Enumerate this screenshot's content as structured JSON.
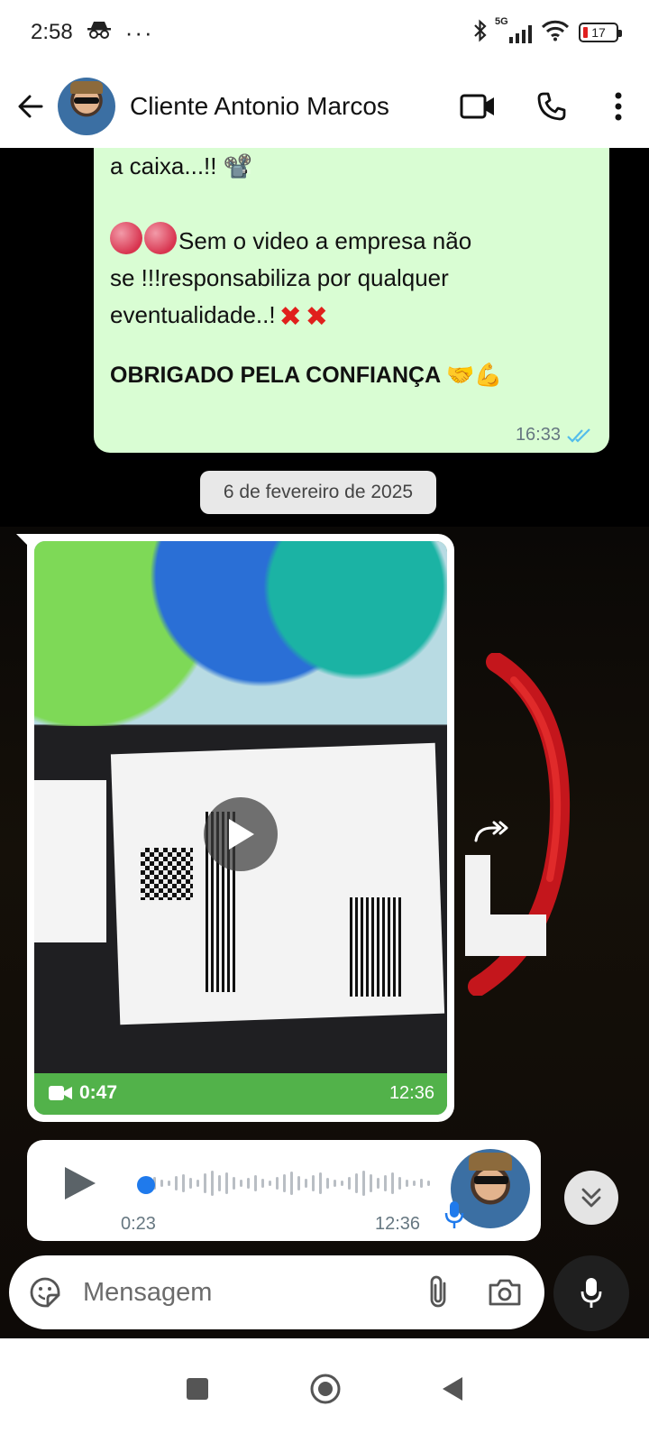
{
  "status_bar": {
    "time": "2:58",
    "dots": "···",
    "network": "5G",
    "battery_level": "17"
  },
  "header": {
    "contact_name": "Cliente Antonio Marcos",
    "icons": [
      "back-arrow-icon",
      "video-call-icon",
      "phone-icon",
      "more-vert-icon"
    ]
  },
  "messages": {
    "outgoing_text": {
      "line1": "a caixa...!! 📽️",
      "line2": "Sem o video a empresa não",
      "line3": "se !!!responsabiliza por qualquer",
      "line4": "eventualidade..!",
      "bold": "OBRIGADO PELA CONFIANÇA 🤝💪",
      "time": "16:33",
      "status": "read"
    },
    "date_separator": "6 de fevereiro de 2025",
    "incoming_video": {
      "duration": "0:47",
      "time": "12:36"
    },
    "incoming_audio": {
      "duration": "0:23",
      "time": "12:36"
    }
  },
  "composer": {
    "placeholder": "Mensagem"
  },
  "colors": {
    "outgoing_bubble": "#d9fdd3",
    "read_ticks": "#53bdeb",
    "audio_dot": "#1f7aec"
  }
}
